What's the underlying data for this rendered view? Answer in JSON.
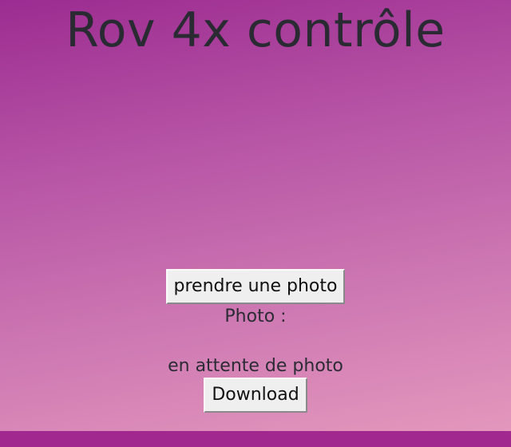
{
  "header": {
    "title": "Rov 4x contrôle"
  },
  "camera": {
    "take_photo_label": "prendre une photo",
    "photo_label": "Photo :",
    "status_text": "en attente de photo",
    "download_label": "Download"
  },
  "colors": {
    "gradient_top": "#9c2c91",
    "gradient_bottom": "#e69abd",
    "bottom_strip": "#a0288f",
    "title_text": "#2a2a33"
  }
}
